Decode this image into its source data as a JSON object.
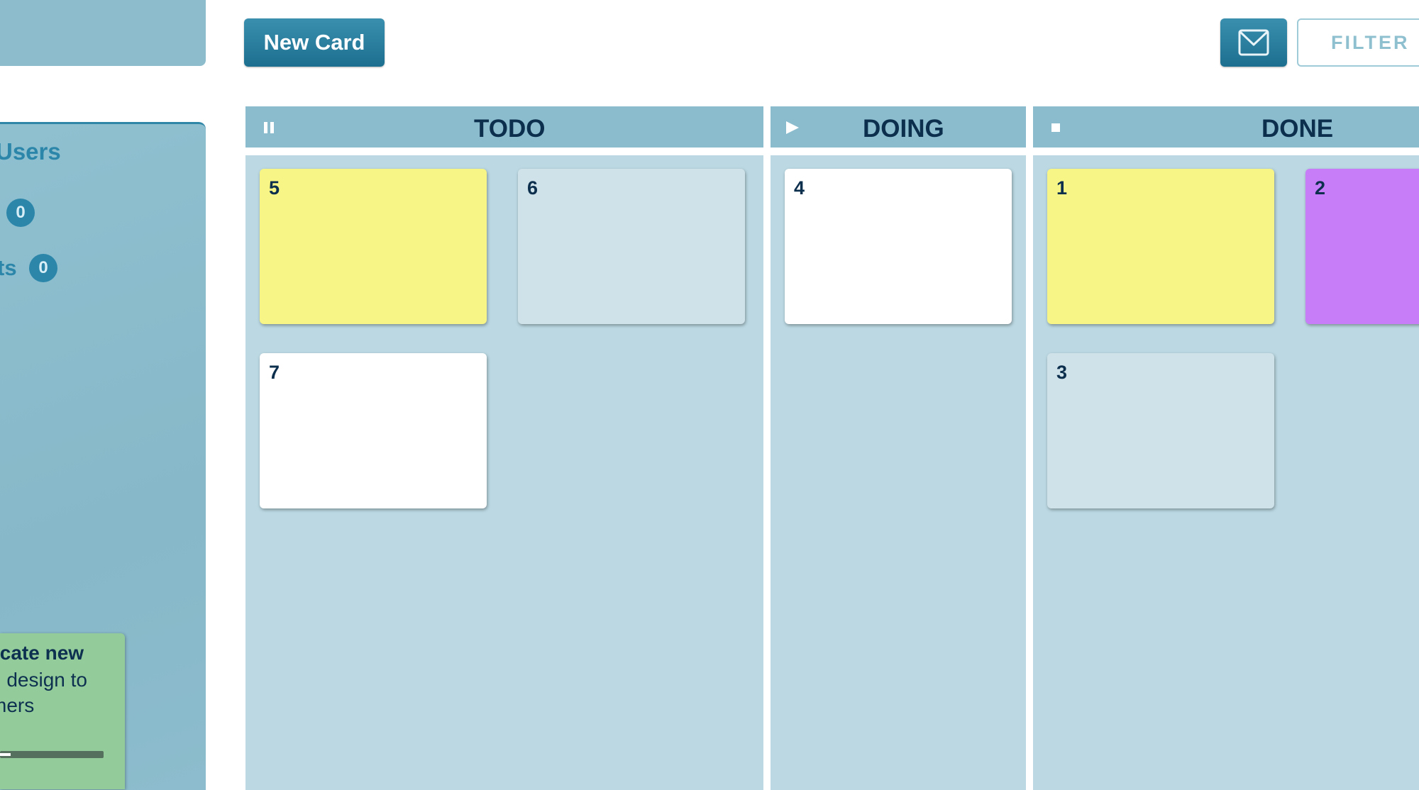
{
  "sidebar": {
    "heading": "Users",
    "rows": [
      {
        "label": "",
        "count": "0"
      },
      {
        "label": "ts",
        "count": "0"
      }
    ],
    "note": {
      "title": "icate new",
      "lines": [
        "d design to",
        "mers"
      ],
      "progress": 0.1,
      "color": "#93cc9a"
    }
  },
  "toolbar": {
    "new_card_label": "New Card",
    "mail_icon": "envelope-icon",
    "filter_label": "FILTER"
  },
  "columns": [
    {
      "title": "TODO",
      "icon": "pause-icon",
      "cards": [
        {
          "number": "5",
          "color": "#f6f586"
        },
        {
          "number": "6",
          "color": "#cfe2e9"
        },
        {
          "number": "7",
          "color": "#ffffff"
        }
      ]
    },
    {
      "title": "DOING",
      "icon": "play-icon",
      "cards": [
        {
          "number": "4",
          "color": "#ffffff"
        }
      ]
    },
    {
      "title": "DONE",
      "icon": "stop-icon",
      "cards": [
        {
          "number": "1",
          "color": "#f6f586"
        },
        {
          "number": "2",
          "color": "#c77cf8"
        },
        {
          "number": "3",
          "color": "#cfe2e9"
        }
      ]
    }
  ],
  "colors": {
    "accent": "#2b86aa",
    "column_header": "#8abccd",
    "column_body": "#bcd9e3",
    "text_dark": "#0d2f4e"
  }
}
